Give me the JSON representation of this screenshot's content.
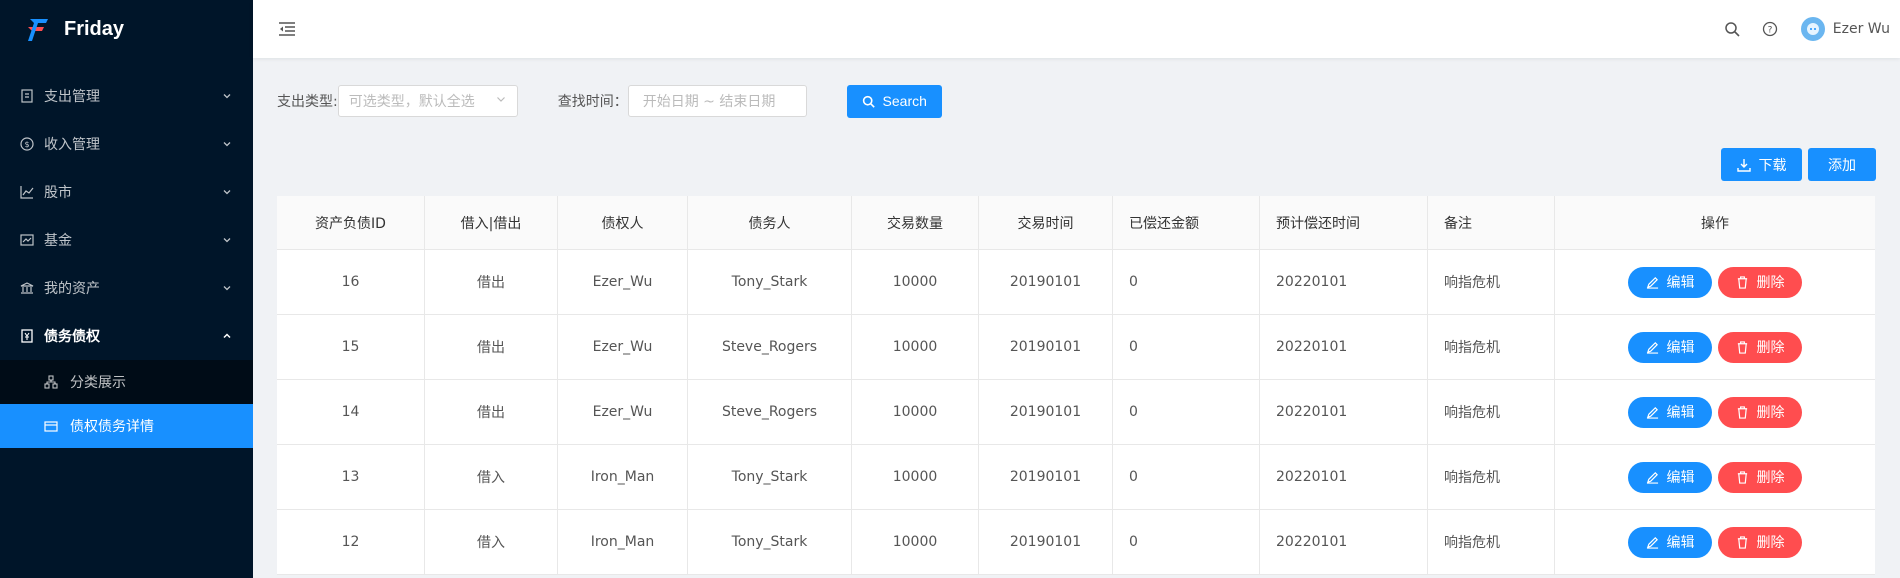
{
  "app": {
    "name": "Friday"
  },
  "sidebar": {
    "items": [
      {
        "label": "支出管理",
        "icon": "receipt-icon"
      },
      {
        "label": "收入管理",
        "icon": "dollar-circle-icon"
      },
      {
        "label": "股市",
        "icon": "line-chart-icon"
      },
      {
        "label": "基金",
        "icon": "fund-chart-icon"
      },
      {
        "label": "我的资产",
        "icon": "bank-icon"
      },
      {
        "label": "债务债权",
        "icon": "document-icon",
        "open": true
      }
    ],
    "subitems": [
      {
        "label": "分类展示",
        "icon": "cluster-icon"
      },
      {
        "label": "债权债务详情",
        "icon": "card-icon",
        "active": true
      }
    ]
  },
  "header": {
    "username": "Ezer Wu"
  },
  "filter": {
    "type_label": "支出类型:",
    "type_placeholder": "可选类型，默认全选",
    "time_label": "查找时间：",
    "date_range_placeholder": "开始日期 ~ 结束日期",
    "search_label": "Search"
  },
  "actions": {
    "download_label": "下载",
    "add_label": "添加"
  },
  "table": {
    "columns": [
      "资产负债ID",
      "借入|借出",
      "债权人",
      "债务人",
      "交易数量",
      "交易时间",
      "已偿还金额",
      "预计偿还时间",
      "备注",
      "操作"
    ],
    "rows": [
      [
        "16",
        "借出",
        "Ezer_Wu",
        "Tony_Stark",
        "10000",
        "20190101",
        "0",
        "20220101",
        "响指危机"
      ],
      [
        "15",
        "借出",
        "Ezer_Wu",
        "Steve_Rogers",
        "10000",
        "20190101",
        "0",
        "20220101",
        "响指危机"
      ],
      [
        "14",
        "借出",
        "Ezer_Wu",
        "Steve_Rogers",
        "10000",
        "20190101",
        "0",
        "20220101",
        "响指危机"
      ],
      [
        "13",
        "借入",
        "Iron_Man",
        "Tony_Stark",
        "10000",
        "20190101",
        "0",
        "20220101",
        "响指危机"
      ],
      [
        "12",
        "借入",
        "Iron_Man",
        "Tony_Stark",
        "10000",
        "20190101",
        "0",
        "20220101",
        "响指危机"
      ]
    ],
    "edit_label": "编辑",
    "delete_label": "删除"
  },
  "colors": {
    "sidebar_bg": "#001529",
    "submenu_bg": "#000c17",
    "primary": "#1890ff",
    "danger": "#ff4d4f",
    "page_bg": "#f0f2f5"
  }
}
